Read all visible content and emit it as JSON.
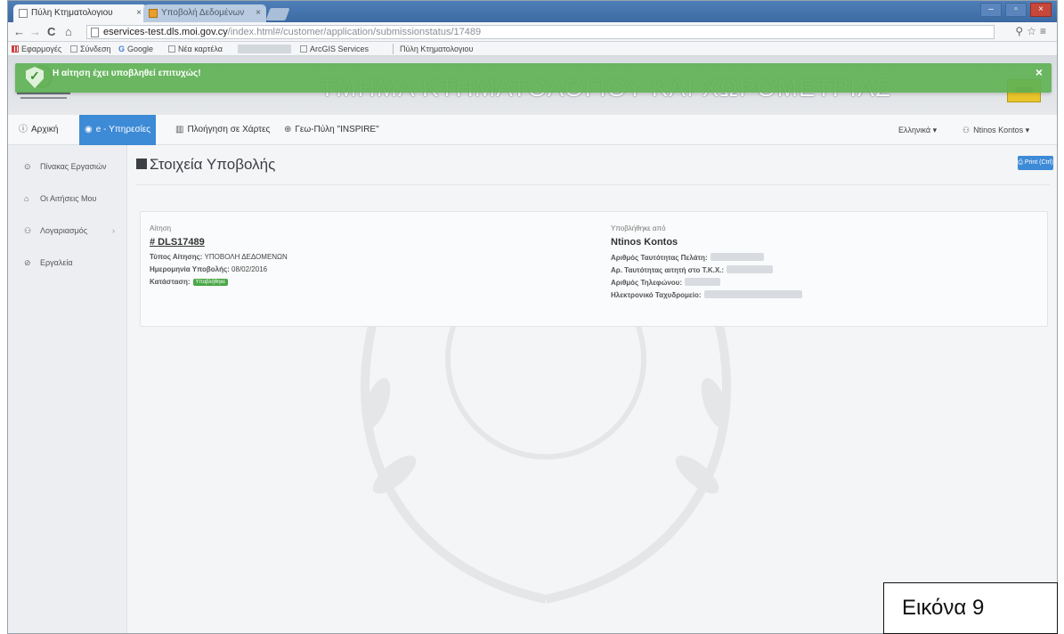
{
  "browser": {
    "tabs": [
      {
        "label": "Πύλη Κτηματολογιου",
        "active": true
      },
      {
        "label": "Υποβολή Δεδομένων",
        "active": false
      }
    ],
    "url_host": "eservices-test.dls.moi.gov.cy",
    "url_path": "/index.html#/customer/application/submissionstatus/17489",
    "bookmarks": [
      "Εφαρμογές",
      "Σύνδεση",
      "Google",
      "Νέα καρτέλα",
      "ArcGIS Services",
      "Πύλη Κτηματολογιου"
    ]
  },
  "banner": {
    "title": "ΤΜΗΜΑ ΚΤΗΜΑΤΟΛΟΓΙΟΥ ΚΑΙ ΧΩΡΟΜΕΤΡΙΑΣ"
  },
  "notification": {
    "message": "Η αίτηση έχει υποβληθεί επιτυχώς!",
    "close": "×"
  },
  "mainnav": {
    "items": [
      {
        "label": "Αρχική",
        "icon": "info-icon"
      },
      {
        "label": "e - Υπηρεσίες",
        "icon": "globe-icon",
        "active": true
      },
      {
        "label": "Πλοήγηση σε Χάρτες",
        "icon": "map-icon"
      },
      {
        "label": "Γεω-Πύλη \"INSPIRE\"",
        "icon": "globe-icon"
      }
    ],
    "language": "Ελληνικά",
    "user": "Ntinos Kontos"
  },
  "sidebar": {
    "items": [
      {
        "label": "Πίνακας Εργασιών",
        "icon": "dashboard-icon"
      },
      {
        "label": "Οι Αιτήσεις Μου",
        "icon": "bank-icon"
      },
      {
        "label": "Λογαριασμός",
        "icon": "user-icon",
        "has_submenu": true
      },
      {
        "label": "Εργαλεία",
        "icon": "help-icon"
      }
    ]
  },
  "page": {
    "title": "Στοιχεία Υποβολής",
    "print_label": "Print (Ctrl)"
  },
  "application": {
    "heading": "Αίτηση",
    "number": "# DLS17489",
    "type_label": "Τύπος Αίτησης:",
    "type_value": "ΥΠΟΒΟΛΗ ΔΕΔΟΜΕΝΩΝ",
    "date_label": "Ημερομηνία Υποβολής:",
    "date_value": "08/02/2016",
    "status_label": "Κατάσταση:",
    "status_value": "Υποβλήθηκε",
    "status_color": "#4aa847"
  },
  "submitter": {
    "heading": "Υποβλήθηκε από",
    "name": "Ntinos Kontos",
    "id_label": "Αριθμός Ταυτότητας Πελάτη:",
    "tkk_label": "Αρ. Ταυτότητας αιτητή στο Τ.Κ.Χ.:",
    "phone_label": "Αριθμός Τηλεφώνου:",
    "email_label": "Ηλεκτρονικό Ταχυδρομείο:"
  },
  "caption": "Εικόνα 9",
  "colors": {
    "accent": "#3d8ad6",
    "success": "#5fb256"
  }
}
